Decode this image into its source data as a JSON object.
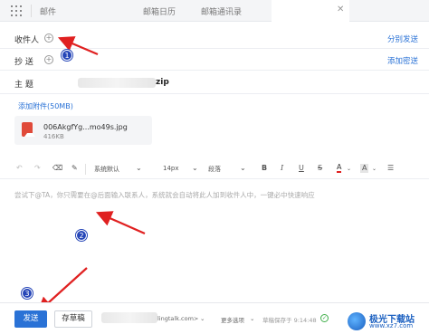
{
  "tabs": [
    {
      "label": "邮件"
    },
    {
      "label": "邮箱日历"
    },
    {
      "label": "邮箱通讯录"
    }
  ],
  "compose": {
    "to_label": "收件人",
    "to_action": "分别发送",
    "cc_label": "抄 送",
    "cc_action": "添加密送",
    "subject_label": "主 题",
    "subject_tail": "zip"
  },
  "attachment": {
    "title": "添加附件(50MB)",
    "file_name": "006AkgfYg...mo49s.jpg",
    "file_size": "416KB"
  },
  "toolbar": {
    "font": "系统默认",
    "size": "14px",
    "paragraph": "段落",
    "bold": "B",
    "italic": "I",
    "underline": "U",
    "strike": "S",
    "font_color": "A",
    "bg_color": "A"
  },
  "body": {
    "placeholder": "尝试下@TA，你只需要在@后面输入联系人，系统就会自动将此人加到收件人中，一键必中快速响应"
  },
  "footer": {
    "send": "发送",
    "save_draft": "存草稿",
    "sender_tail": "lingtalk.com>",
    "more": "更多选项",
    "autosave": "草稿保存于 9:14:48"
  },
  "annotations": {
    "badge_1": "1",
    "badge_2": "2",
    "badge_3": "3"
  },
  "watermark": {
    "name": "极光下载站",
    "url": "www.xz7.com"
  },
  "colors": {
    "accent": "#2a72d6",
    "arrow": "#e02020",
    "badge": "#2646b8"
  }
}
